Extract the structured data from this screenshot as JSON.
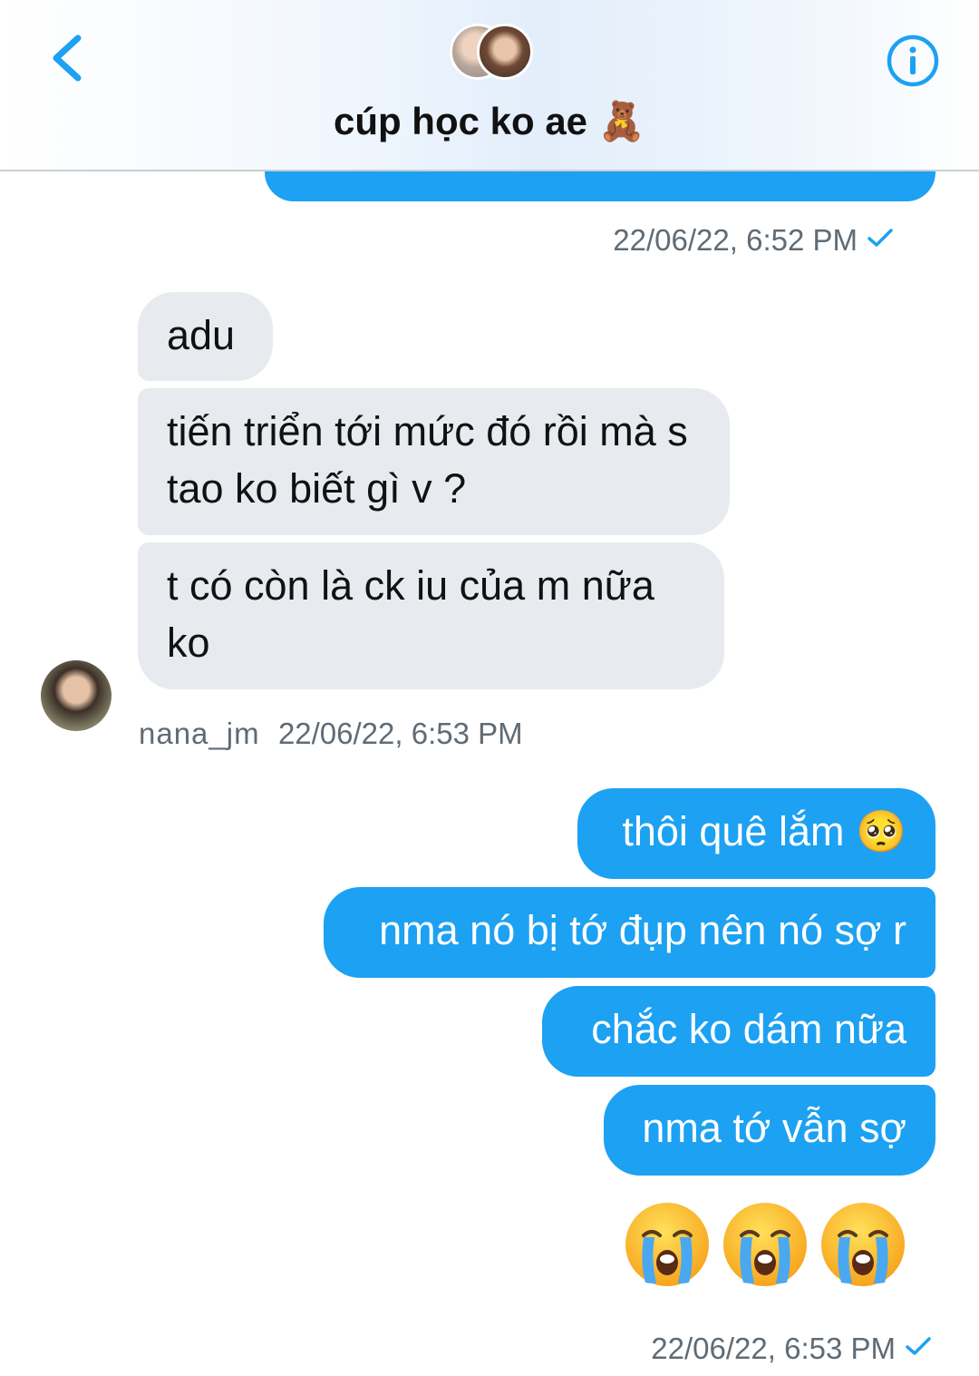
{
  "header": {
    "title": "cúp học ko ae 🧸"
  },
  "messages": {
    "outgoing_prev_timestamp": "22/06/22, 6:52 PM",
    "incoming": [
      "adu",
      "tiến triển tới mức đó rồi mà s tao ko biết gì v ?",
      "t có còn là ck iu của m nữa ko"
    ],
    "incoming_sender": "nana_jm",
    "incoming_timestamp": "22/06/22, 6:53 PM",
    "outgoing": [
      "thôi quê lắm 🥺",
      "nma nó bị tớ đụp nên nó sợ r",
      "chắc ko dám nữa",
      "nma tớ vẫn sợ"
    ],
    "outgoing_emoji": "😭😭😭",
    "outgoing_timestamp": "22/06/22, 6:53 PM"
  },
  "colors": {
    "outgoing_bubble": "#1da1f2",
    "incoming_bubble": "#e7ebef",
    "accent": "#1da1f2"
  },
  "icons": [
    "chevron-left-icon",
    "info-icon",
    "check-icon",
    "crying-face-icon"
  ]
}
